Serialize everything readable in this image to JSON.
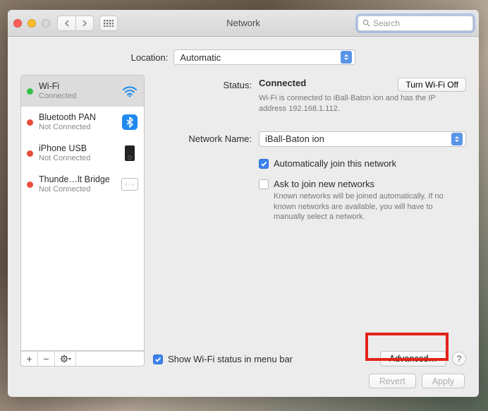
{
  "window": {
    "title": "Network"
  },
  "toolbar": {
    "search_placeholder": "Search"
  },
  "location": {
    "label": "Location:",
    "value": "Automatic"
  },
  "sidebar": {
    "items": [
      {
        "name": "Wi-Fi",
        "status": "Connected",
        "dot": "green",
        "icon": "wifi",
        "selected": true
      },
      {
        "name": "Bluetooth PAN",
        "status": "Not Connected",
        "dot": "red",
        "icon": "bluetooth",
        "selected": false
      },
      {
        "name": "iPhone USB",
        "status": "Not Connected",
        "dot": "red",
        "icon": "phone",
        "selected": false
      },
      {
        "name": "Thunde…lt Bridge",
        "status": "Not Connected",
        "dot": "red",
        "icon": "thunderbolt",
        "selected": false
      }
    ]
  },
  "details": {
    "status_label": "Status:",
    "status_value": "Connected",
    "turn_off_label": "Turn Wi-Fi Off",
    "status_desc": "Wi-Fi is connected to iBall-Baton ion and has the IP address 192.168.1.112.",
    "network_name_label": "Network Name:",
    "network_name_value": "iBall-Baton ion",
    "auto_join": {
      "checked": true,
      "label": "Automatically join this network"
    },
    "ask_join": {
      "checked": false,
      "label": "Ask to join new networks",
      "desc": "Known networks will be joined automatically. If no known networks are available, you will have to manually select a network."
    },
    "show_status": {
      "checked": true,
      "label": "Show Wi-Fi status in menu bar"
    },
    "advanced_label": "Advanced…",
    "help_label": "?"
  },
  "footer": {
    "revert": "Revert",
    "apply": "Apply"
  }
}
